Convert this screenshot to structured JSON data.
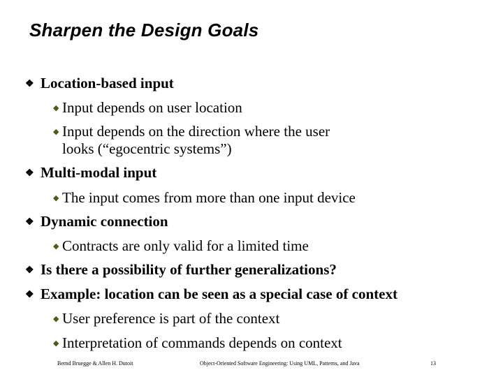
{
  "slide": {
    "title": "Sharpen the Design Goals",
    "icons": {
      "main_bullet": "❖",
      "sub_bullet": "◆"
    },
    "bullets": [
      {
        "text": "Location-based input",
        "subs": [
          "Input depends on user location",
          "Input depends on the direction where the user",
          "looks (“egocentric systems”)"
        ]
      },
      {
        "text": "Multi-modal input",
        "subs": [
          "The input comes from more than one input device"
        ]
      },
      {
        "text": "Dynamic connection",
        "subs": [
          "Contracts are only valid for a limited time"
        ]
      },
      {
        "text": "Is there a possibility of further generalizations?",
        "subs": []
      },
      {
        "text": "Example: location can be seen as a special case of context",
        "subs": [
          "User preference is part of the context",
          "Interpretation of commands depends on context"
        ]
      }
    ]
  },
  "footer": {
    "authors": "Bernd Bruegge & Allen H. Dutoit",
    "book": "Object-Oriented Software Engineering: Using UML, Patterns, and Java",
    "page": "13"
  }
}
